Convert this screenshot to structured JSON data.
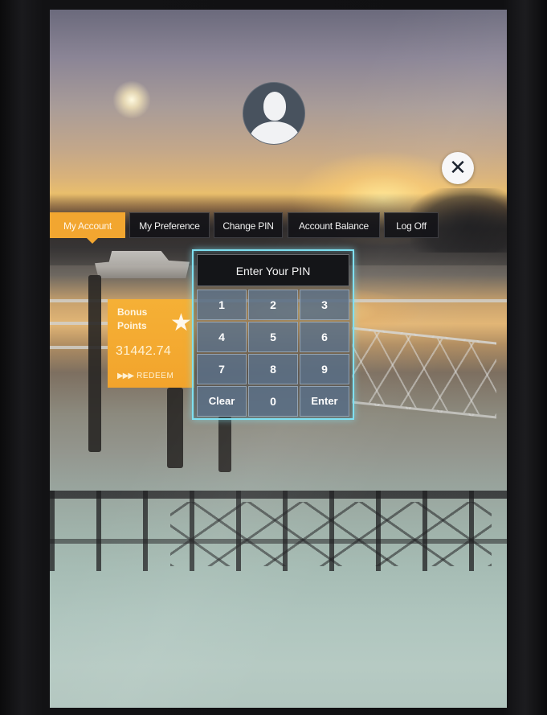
{
  "menu": {
    "items": [
      {
        "label": "My Account",
        "active": true
      },
      {
        "label": "My Preference",
        "active": false
      },
      {
        "label": "Change PIN",
        "active": false
      },
      {
        "label": "Account Balance",
        "active": false
      },
      {
        "label": "Log Off",
        "active": false
      }
    ]
  },
  "close_button": {
    "icon": "close-icon",
    "glyph": "✕"
  },
  "avatar": {
    "icon": "user-silhouette-icon"
  },
  "bonus": {
    "label": "Bonus Points",
    "value": "31442.74",
    "redeem": "REDEEM",
    "arrows": "▶▶▶",
    "star": "★"
  },
  "pinpad": {
    "title": "Enter Your PIN",
    "keys": [
      "1",
      "2",
      "3",
      "4",
      "5",
      "6",
      "7",
      "8",
      "9",
      "Clear",
      "0",
      "Enter"
    ]
  },
  "colors": {
    "accent": "#f2a630",
    "menu_bg": "#141418",
    "pinpad_border": "#7fe0f1",
    "key_bg": "#5c728a"
  }
}
